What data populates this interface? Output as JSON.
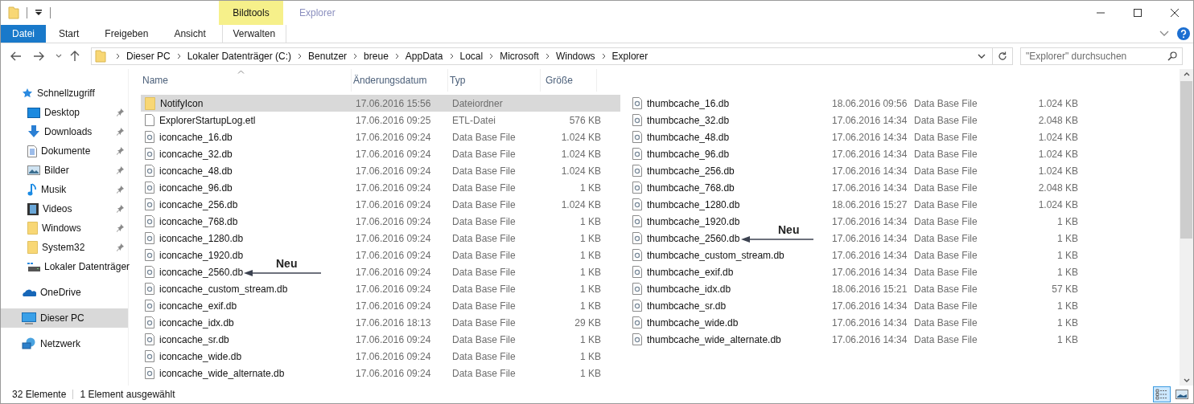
{
  "window": {
    "title": "Explorer",
    "context_group": "Bildtools"
  },
  "ribbon_tabs": [
    {
      "label": "Datei",
      "kind": "file"
    },
    {
      "label": "Start",
      "kind": "tab"
    },
    {
      "label": "Freigeben",
      "kind": "tab"
    },
    {
      "label": "Ansicht",
      "kind": "tab"
    },
    {
      "label": "Verwalten",
      "kind": "contextual"
    }
  ],
  "address": {
    "parts": [
      "Dieser PC",
      "Lokaler Datenträger (C:)",
      "Benutzer",
      "breue",
      "AppData",
      "Local",
      "Microsoft",
      "Windows",
      "Explorer"
    ]
  },
  "search": {
    "placeholder": "\"Explorer\" durchsuchen"
  },
  "sidebar": {
    "items": [
      {
        "label": "Schnellzugriff",
        "kind": "star",
        "selected": false,
        "children": [
          {
            "label": "Desktop",
            "kind": "desktop",
            "pinned": true,
            "selected": false
          },
          {
            "label": "Downloads",
            "kind": "download",
            "pinned": true,
            "selected": false
          },
          {
            "label": "Dokumente",
            "kind": "document",
            "pinned": true,
            "selected": false
          },
          {
            "label": "Bilder",
            "kind": "pictures",
            "pinned": true,
            "selected": false
          },
          {
            "label": "Musik",
            "kind": "music",
            "pinned": true,
            "selected": false
          },
          {
            "label": "Videos",
            "kind": "videos",
            "pinned": true,
            "selected": false
          },
          {
            "label": "Windows",
            "kind": "folder",
            "pinned": true,
            "selected": false
          },
          {
            "label": "System32",
            "kind": "folder",
            "pinned": true,
            "selected": false
          },
          {
            "label": "Lokaler Datenträger",
            "kind": "drive",
            "pinned": false,
            "selected": false
          }
        ]
      },
      {
        "label": "OneDrive",
        "kind": "cloud",
        "selected": false
      },
      {
        "label": "Dieser PC",
        "kind": "pc",
        "selected": true
      },
      {
        "label": "Netzwerk",
        "kind": "network",
        "selected": false
      }
    ]
  },
  "columns": [
    "Name",
    "Änderungsdatum",
    "Typ",
    "Größe"
  ],
  "left_rows": [
    {
      "name": "NotifyIcon",
      "date": "17.06.2016 15:56",
      "type": "Dateiordner",
      "kind": "folder",
      "selected": true
    },
    {
      "name": "ExplorerStartupLog.etl",
      "date": "17.06.2016 09:25",
      "type": "ETL-Datei",
      "size": "576 KB",
      "kind": "file",
      "selected": false
    },
    {
      "name": "iconcache_16.db",
      "date": "17.06.2016 09:24",
      "type": "Data Base File",
      "size": "1.024 KB",
      "kind": "db",
      "selected": false
    },
    {
      "name": "iconcache_32.db",
      "date": "17.06.2016 09:24",
      "type": "Data Base File",
      "size": "1.024 KB",
      "kind": "db",
      "selected": false
    },
    {
      "name": "iconcache_48.db",
      "date": "17.06.2016 09:24",
      "type": "Data Base File",
      "size": "1.024 KB",
      "kind": "db",
      "selected": false
    },
    {
      "name": "iconcache_96.db",
      "date": "17.06.2016 09:24",
      "type": "Data Base File",
      "size": "1 KB",
      "kind": "db",
      "selected": false
    },
    {
      "name": "iconcache_256.db",
      "date": "17.06.2016 09:24",
      "type": "Data Base File",
      "size": "1.024 KB",
      "kind": "db",
      "selected": false
    },
    {
      "name": "iconcache_768.db",
      "date": "17.06.2016 09:24",
      "type": "Data Base File",
      "size": "1 KB",
      "kind": "db",
      "selected": false
    },
    {
      "name": "iconcache_1280.db",
      "date": "17.06.2016 09:24",
      "type": "Data Base File",
      "size": "1 KB",
      "kind": "db",
      "selected": false
    },
    {
      "name": "iconcache_1920.db",
      "date": "17.06.2016 09:24",
      "type": "Data Base File",
      "size": "1 KB",
      "kind": "db",
      "selected": false
    },
    {
      "name": "iconcache_2560.db",
      "date": "17.06.2016 09:24",
      "type": "Data Base File",
      "size": "1 KB",
      "kind": "db",
      "selected": false,
      "note": "Neu"
    },
    {
      "name": "iconcache_custom_stream.db",
      "date": "17.06.2016 09:24",
      "type": "Data Base File",
      "size": "1 KB",
      "kind": "db",
      "selected": false
    },
    {
      "name": "iconcache_exif.db",
      "date": "17.06.2016 09:24",
      "type": "Data Base File",
      "size": "1 KB",
      "kind": "db",
      "selected": false
    },
    {
      "name": "iconcache_idx.db",
      "date": "17.06.2016 18:13",
      "type": "Data Base File",
      "size": "29 KB",
      "kind": "db",
      "selected": false
    },
    {
      "name": "iconcache_sr.db",
      "date": "17.06.2016 09:24",
      "type": "Data Base File",
      "size": "1 KB",
      "kind": "db",
      "selected": false
    },
    {
      "name": "iconcache_wide.db",
      "date": "17.06.2016 09:24",
      "type": "Data Base File",
      "size": "1 KB",
      "kind": "db",
      "selected": false
    },
    {
      "name": "iconcache_wide_alternate.db",
      "date": "17.06.2016 09:24",
      "type": "Data Base File",
      "size": "1 KB",
      "kind": "db",
      "selected": false
    }
  ],
  "right_rows": [
    {
      "name": "thumbcache_16.db",
      "date": "18.06.2016 09:56",
      "type": "Data Base File",
      "size": "1.024 KB",
      "kind": "db",
      "selected": false
    },
    {
      "name": "thumbcache_32.db",
      "date": "17.06.2016 14:34",
      "type": "Data Base File",
      "size": "2.048 KB",
      "kind": "db",
      "selected": false
    },
    {
      "name": "thumbcache_48.db",
      "date": "17.06.2016 14:34",
      "type": "Data Base File",
      "size": "1.024 KB",
      "kind": "db",
      "selected": false
    },
    {
      "name": "thumbcache_96.db",
      "date": "17.06.2016 14:34",
      "type": "Data Base File",
      "size": "1.024 KB",
      "kind": "db",
      "selected": false
    },
    {
      "name": "thumbcache_256.db",
      "date": "17.06.2016 14:34",
      "type": "Data Base File",
      "size": "1.024 KB",
      "kind": "db",
      "selected": false
    },
    {
      "name": "thumbcache_768.db",
      "date": "17.06.2016 14:34",
      "type": "Data Base File",
      "size": "2.048 KB",
      "kind": "db",
      "selected": false
    },
    {
      "name": "thumbcache_1280.db",
      "date": "18.06.2016 15:27",
      "type": "Data Base File",
      "size": "1.024 KB",
      "kind": "db",
      "selected": false
    },
    {
      "name": "thumbcache_1920.db",
      "date": "17.06.2016 14:34",
      "type": "Data Base File",
      "size": "1 KB",
      "kind": "db",
      "selected": false
    },
    {
      "name": "thumbcache_2560.db",
      "date": "17.06.2016 14:34",
      "type": "Data Base File",
      "size": "1 KB",
      "kind": "db",
      "selected": false,
      "note": "Neu"
    },
    {
      "name": "thumbcache_custom_stream.db",
      "date": "17.06.2016 14:34",
      "type": "Data Base File",
      "size": "1 KB",
      "kind": "db",
      "selected": false
    },
    {
      "name": "thumbcache_exif.db",
      "date": "17.06.2016 14:34",
      "type": "Data Base File",
      "size": "1 KB",
      "kind": "db",
      "selected": false
    },
    {
      "name": "thumbcache_idx.db",
      "date": "18.06.2016 15:21",
      "type": "Data Base File",
      "size": "57 KB",
      "kind": "db",
      "selected": false
    },
    {
      "name": "thumbcache_sr.db",
      "date": "17.06.2016 14:34",
      "type": "Data Base File",
      "size": "1 KB",
      "kind": "db",
      "selected": false
    },
    {
      "name": "thumbcache_wide.db",
      "date": "17.06.2016 14:34",
      "type": "Data Base File",
      "size": "1 KB",
      "kind": "db",
      "selected": false
    },
    {
      "name": "thumbcache_wide_alternate.db",
      "date": "17.06.2016 14:34",
      "type": "Data Base File",
      "size": "1 KB",
      "kind": "db",
      "selected": false
    }
  ],
  "status_bar": {
    "count": "32 Elemente",
    "selection": "1 Element ausgewählt"
  },
  "view_buttons": [
    {
      "kind": "details",
      "selected": true
    },
    {
      "kind": "thumbnails",
      "selected": false
    }
  ]
}
